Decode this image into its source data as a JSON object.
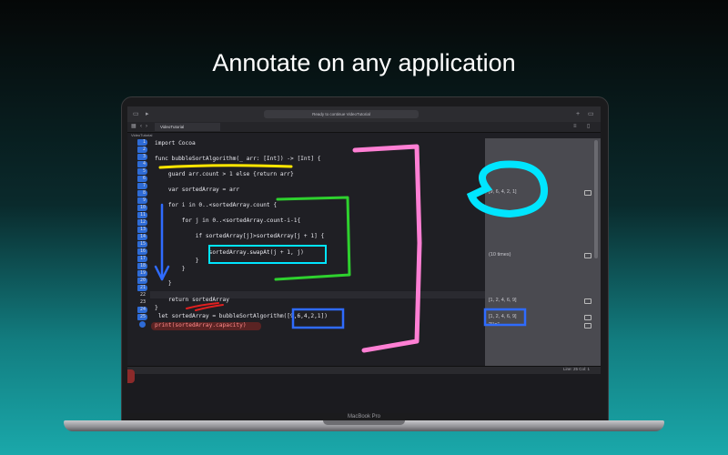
{
  "headline": "Annotate on any application",
  "device": {
    "brand": "MacBook Pro"
  },
  "editor": {
    "status_text": "Ready to continue VideoTutorial",
    "tab_label": "VideoTutorial",
    "breadcrumb": "VideoTutorial",
    "line_numbers": [
      "1",
      "2",
      "3",
      "4",
      "5",
      "6",
      "7",
      "8",
      "9",
      "10",
      "11",
      "12",
      "13",
      "14",
      "15",
      "16",
      "17",
      "18",
      "19",
      "20",
      "21",
      "22",
      "23",
      "24",
      "25"
    ],
    "code_lines": [
      "import Cocoa",
      "",
      "func bubbleSortAlgorithm(_ arr: [Int]) -> [Int] {",
      "",
      "    guard arr.count > 1 else {return arr}",
      "",
      "    var sortedArray = arr",
      "",
      "    for i in 0..<sortedArray.count {",
      "",
      "        for j in 0..<sortedArray.count-i-1{",
      "",
      "            if sortedArray[j]>sortedArray[j + 1] {",
      "",
      "                sortedArray.swapAt(j + 1, j)",
      "            }",
      "        }",
      "",
      "    }",
      "",
      "    return sortedArray",
      "}",
      " let sortedArray = bubbleSortAlgorithm([9,6,4,2,1])",
      "print(sortedArray.capacity)",
      ""
    ],
    "results": {
      "r1": "[9, 6, 4, 2, 1]",
      "r2": "(10 times)",
      "r3": "[1, 2, 4, 6, 9]",
      "r4": "[1, 2, 4, 6, 9]",
      "r5": "\"5\\n\""
    },
    "cursor_position": "Line: 25  Col: 1"
  },
  "colors": {
    "annotation_pink": "#ff7fd4",
    "annotation_cyan": "#00e5ff",
    "annotation_green": "#2ed12e",
    "annotation_blue": "#2f6bff",
    "annotation_yellow": "#ffe600",
    "annotation_red": "#e02020"
  }
}
